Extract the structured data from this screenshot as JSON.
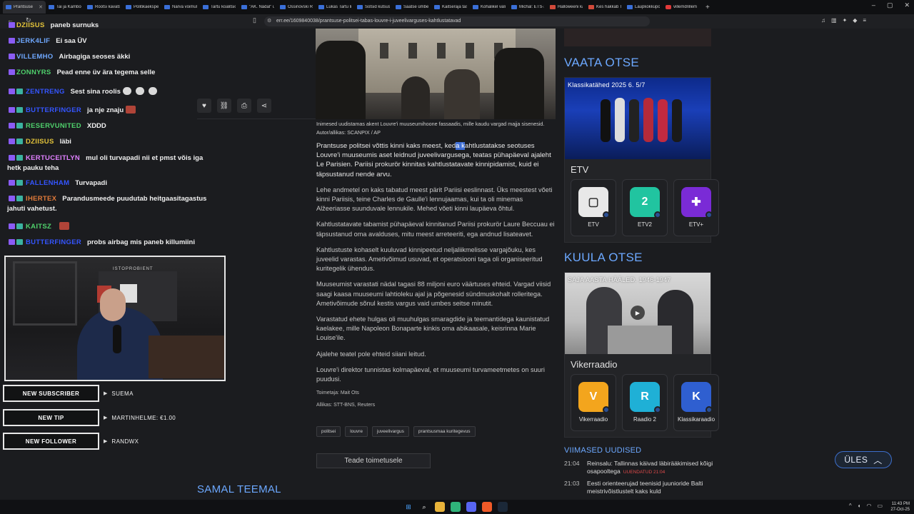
{
  "browser": {
    "tabs": [
      {
        "label": "Prantsuse",
        "active": true
      },
      {
        "label": "Tai ja Kambod"
      },
      {
        "label": "Rootsi kavatse"
      },
      {
        "label": "Politikaeksper"
      },
      {
        "label": "Narva võimuli"
      },
      {
        "label": "Tartu koalitsio"
      },
      {
        "label": "\"AK. Nädal\" uu"
      },
      {
        "label": "Ossinovski Res"
      },
      {
        "label": "Lukas Tartu linn"
      },
      {
        "label": "Sotsid kutsusi"
      },
      {
        "label": "Saatse ümbers"
      },
      {
        "label": "Kaitseraja taste"
      },
      {
        "label": "Kohalikel valimi"
      },
      {
        "label": "Michal: ETS-2"
      },
      {
        "label": "Halloweeni ka"
      },
      {
        "label": "Kes hakkab Tall"
      },
      {
        "label": "Laupkokkupõr"
      },
      {
        "label": "villemdrillem"
      }
    ],
    "new_tab": "+",
    "url": "err.ee/1609840038/prantsuse-politsei-tabas-louvre-i-juveelivarguses-kahtlustatavad"
  },
  "chat": {
    "messages": [
      {
        "user": "DZIISUS",
        "text": "paneb surnuks",
        "color": "#e3c33a"
      },
      {
        "user": "JERK4LIF",
        "text": "Ei saa ÜV",
        "color": "#6fa8ff"
      },
      {
        "user": "VILLEMHO",
        "text": "Airbagiga seoses äkki",
        "color": "#6fa8ff"
      },
      {
        "user": "ZONNYRS",
        "text": "Pead enne üv ära tegema selle",
        "color": "#4fd16c"
      },
      {
        "user": "ZENTRENG",
        "text": "Sest sina roolis",
        "color": "#3455ff"
      },
      {
        "user": "BUTTERFINGER",
        "text": "ja nje znaju",
        "color": "#3455ff"
      },
      {
        "user": "RESERVUNITED",
        "text": "XDDD",
        "color": "#4fd16c"
      },
      {
        "user": "DZIISUS",
        "text": "läbi",
        "color": "#e3c33a"
      },
      {
        "user": "KERTUCEITLYN",
        "text": "mul oli turvapadi nii et pmst võis iga",
        "text2": "hetk pauku teha",
        "color": "#e080ff"
      },
      {
        "user": "FALLENHAM",
        "text": "Turvapadi",
        "color": "#3455ff"
      },
      {
        "user": "IHERTEX",
        "text": "Parandusmeede puudutab heitgaasitagastus",
        "text2": "jahuti vahetust.",
        "color": "#e07a3a"
      },
      {
        "user": "KAITSZ",
        "text": "",
        "color": "#4fd16c"
      },
      {
        "user": "BUTTERFINGER",
        "text": "probs airbag mis paneb killumiini",
        "color": "#3455ff"
      }
    ],
    "alerts": [
      {
        "label": "NEW SUBSCRIBER",
        "value": "SUEMA"
      },
      {
        "label": "NEW TIP",
        "value": "MARTINHELME: €1.00"
      },
      {
        "label": "NEW FOLLOWER",
        "value": "RANDWX"
      }
    ],
    "cam_logo": "ISTOPROBIENT"
  },
  "article": {
    "caption": "Inimesed uudistamas akent Louvre'i muuseumihoone fassaadis, mille kaudu vargad majja sisenesid. Autor/allikas: SCANPIX / AP",
    "lead_before": "Prantsuse politsei võttis kinni kaks meest, ked",
    "lead_highlight": "a k",
    "lead_after": "ahtlustatakse seotuses Louvre'i muuseumis aset leidnud juveelivargusega, teatas pühapäeval ajaleht Le Parisien. Pariisi prokurör kinnitas kahtlustatavate kinnipidamist, kuid ei täpsustanud nende arvu.",
    "paragraphs": [
      "Lehe andmetel on kaks tabatud meest pärit Pariisi eeslinnast. Üks meestest võeti kinni Pariisis, teine Charles de Gaulle'i lennujaamas, kui ta oli minemas Alžeeriasse suunduvale lennukile. Mehed võeti kinni laupäeva õhtul.",
      "Kahtlustatavate tabamist pühapäeval kinnitanud Pariisi prokurör Laure Beccuau ei täpsustanud oma avalduses, mitu meest arreteeriti, ega andnud lisateavet.",
      "Kahtlustuste kohaselt kuuluvad kinnipeetud neljaliikmelisse vargajõuku, kes juveelid varastas. Ametivõimud usuvad, et operatsiooni taga oli organiseeritud kuritegelik ühendus.",
      "Muuseumist varastati nädal tagasi 88 miljoni euro väärtuses ehteid. Vargad viisid saagi kaasa muuseumi lahtioleku ajal ja põgenesid sündmuskohalt rolleritega. Ametivõimude sõnul kestis vargus vaid umbes seitse minutit.",
      "Varastatud ehete hulgas oli muuhulgas smaragdide ja teemantidega kaunistatud kaelakee, mille Napoleon Bonaparte kinkis oma abikaasale, keisrinna Marie Louise'ile.",
      "Ajalehe teatel pole ehteid siiani leitud.",
      "Louvre'i direktor tunnistas kolmapäeval, et muuseumi turvameetmetes on suuri puudusi."
    ],
    "editor": "Toimetaja: Mait Ots",
    "source": "Allikas: STT-BNS, Reuters",
    "tags": [
      "politsei",
      "louvre",
      "juveelivargus",
      "prantsusmaa kuritegevus"
    ],
    "feedback_button": "Teade toimetusele",
    "same_topic": "SAMAL TEEMAL"
  },
  "sidebar": {
    "watch_title": "VAATA OTSE",
    "watch_overlay": "Klassikatähed 2025 6. 5/7",
    "watch_name": "ETV",
    "tv_channels": [
      {
        "label": "ETV",
        "color": "#e8e8e8",
        "glyph": "▢"
      },
      {
        "label": "ETV2",
        "color": "#21c4a0",
        "glyph": "2"
      },
      {
        "label": "ETV+",
        "color": "#7a2bd6",
        "glyph": "✚"
      }
    ],
    "listen_title": "KUULA OTSE",
    "listen_overlay": "SAJA AASTA HÄÄLED. 1946-1947",
    "listen_name": "Vikerraadio",
    "radio_channels": [
      {
        "label": "Vikerraadio",
        "color": "#f3a51d",
        "glyph": "V"
      },
      {
        "label": "Raadio 2",
        "color": "#1fb0d6",
        "glyph": "R"
      },
      {
        "label": "Klassikaraadio",
        "color": "#2f5fd0",
        "glyph": "K"
      }
    ],
    "news_title": "VIIMASED UUDISED",
    "news": [
      {
        "time": "21:04",
        "text": "Reinsalu: Tallinnas käivad läbirääkimised kõigi osapooltega",
        "updated": "UUENDATUD 21:04"
      },
      {
        "time": "21:03",
        "text": "Eesti orienteerujad teenisid juunioride Balti meistrivõistlustelt kaks kuld"
      }
    ]
  },
  "up_button": "ÜLES",
  "taskbar": {
    "time": "11:43 PM",
    "date": "27-Oct-25"
  },
  "colors": {
    "accent": "#6ca8ff",
    "background": "#1b1c1f",
    "highlight": "#3f6fd6"
  }
}
